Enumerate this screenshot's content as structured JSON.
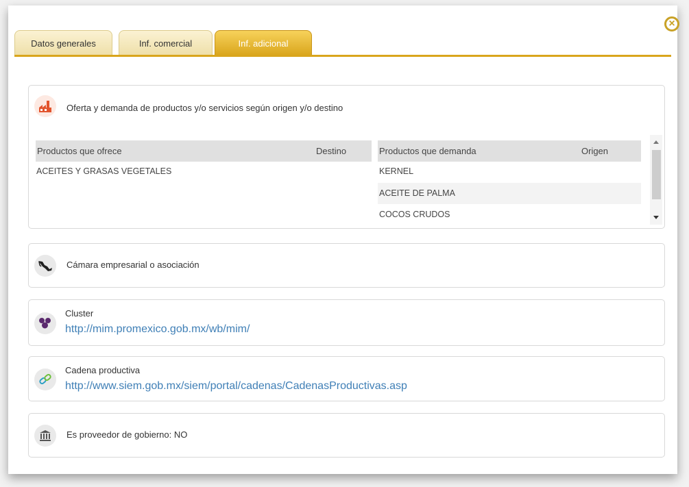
{
  "tabs": [
    {
      "label": "Datos generales",
      "active": false
    },
    {
      "label": "Inf. comercial",
      "active": false
    },
    {
      "label": "Inf. adicional",
      "active": true
    }
  ],
  "close_symbol": "×",
  "oferta": {
    "title": "Oferta y demanda de productos y/o servicios según origen y/o destino",
    "icon": "factory-icon",
    "headers": {
      "ofrece": "Productos que ofrece",
      "destino": "Destino",
      "demanda": "Productos que demanda",
      "origen": "Origen"
    },
    "ofrece_rows": [
      {
        "producto": "ACEITES Y GRASAS VEGETALES",
        "destino": ""
      }
    ],
    "demanda_rows": [
      {
        "producto": "KERNEL",
        "origen": ""
      },
      {
        "producto": "ACEITE DE PALMA",
        "origen": ""
      },
      {
        "producto": "COCOS CRUDOS",
        "origen": ""
      }
    ]
  },
  "camara": {
    "title": "Cámara empresarial o asociación",
    "icon": "mexico-map-icon"
  },
  "cluster": {
    "title": "Cluster",
    "link": "http://mim.promexico.gob.mx/wb/mim/",
    "icon": "grapes-icon"
  },
  "cadena": {
    "title": "Cadena productiva",
    "link": "http://www.siem.gob.mx/siem/portal/cadenas/CadenasProductivas.asp",
    "icon": "chain-link-icon"
  },
  "proveedor": {
    "label": "Es proveedor de gobierno: NO",
    "icon": "government-building-icon"
  },
  "colors": {
    "accent": "#d9a51c",
    "link": "#3f7fb6"
  }
}
